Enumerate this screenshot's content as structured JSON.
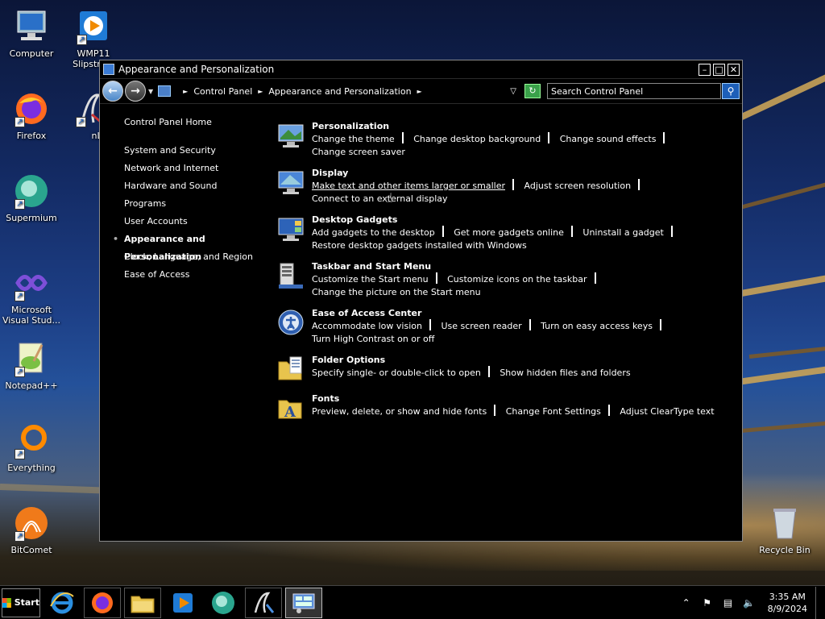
{
  "desktop": {
    "icons": [
      {
        "label": "Computer",
        "icon": "computer-icon"
      },
      {
        "label": "WMP11 Slipstre...",
        "icon": "wmp-icon"
      },
      {
        "label": "Firefox",
        "icon": "firefox-icon"
      },
      {
        "label": "nLit",
        "icon": "nlite-icon"
      },
      {
        "label": "Supermium",
        "icon": "supermium-icon"
      },
      {
        "label": "Microsoft Visual Stud...",
        "icon": "visual-studio-icon"
      },
      {
        "label": "Notepad++",
        "icon": "notepadpp-icon"
      },
      {
        "label": "Everything",
        "icon": "everything-icon"
      },
      {
        "label": "BitComet",
        "icon": "bitcomet-icon"
      },
      {
        "label": "Recycle Bin",
        "icon": "recycle-bin-icon"
      }
    ]
  },
  "window": {
    "title": "Appearance and Personalization",
    "breadcrumb": [
      "Control Panel",
      "Appearance and Personalization"
    ],
    "search_placeholder": "Search Control Panel",
    "min_glyph": "–",
    "max_glyph": "□",
    "close_glyph": "✕"
  },
  "leftnav": {
    "home": "Control Panel Home",
    "items": [
      "System and Security",
      "Network and Internet",
      "Hardware and Sound",
      "Programs",
      "User Accounts",
      "Appearance and Personalization",
      "Clock, Language, and Region",
      "Ease of Access"
    ],
    "active_index": 5
  },
  "categories": [
    {
      "title": "Personalization",
      "icon": "personalization-icon",
      "links": [
        "Change the theme",
        "Change desktop background",
        "Change sound effects",
        "Change screen saver"
      ]
    },
    {
      "title": "Display",
      "icon": "display-icon",
      "links": [
        "Make text and other items larger or smaller",
        "Adjust screen resolution",
        "Connect to an external display"
      ]
    },
    {
      "title": "Desktop Gadgets",
      "icon": "gadgets-icon",
      "links": [
        "Add gadgets to the desktop",
        "Get more gadgets online",
        "Uninstall a gadget",
        "Restore desktop gadgets installed with Windows"
      ]
    },
    {
      "title": "Taskbar and Start Menu",
      "icon": "taskbar-icon",
      "links": [
        "Customize the Start menu",
        "Customize icons on the taskbar",
        "Change the picture on the Start menu"
      ]
    },
    {
      "title": "Ease of Access Center",
      "icon": "ease-of-access-icon",
      "links": [
        "Accommodate low vision",
        "Use screen reader",
        "Turn on easy access keys",
        "Turn High Contrast on or off"
      ]
    },
    {
      "title": "Folder Options",
      "icon": "folder-options-icon",
      "links": [
        "Specify single- or double-click to open",
        "Show hidden files and folders"
      ]
    },
    {
      "title": "Fonts",
      "icon": "fonts-icon",
      "links": [
        "Preview, delete, or show and hide fonts",
        "Change Font Settings",
        "Adjust ClearType text"
      ]
    }
  ],
  "taskbar": {
    "start_label": "Start",
    "time": "3:35 AM",
    "date": "8/9/2024",
    "buttons": [
      "internet-explorer-icon",
      "firefox-icon",
      "file-explorer-icon",
      "media-player-icon",
      "supermium-icon",
      "nlite-icon",
      "control-panel-icon"
    ]
  },
  "colors": {
    "window_bg": "#000000",
    "accent": "#1d5fb8"
  }
}
